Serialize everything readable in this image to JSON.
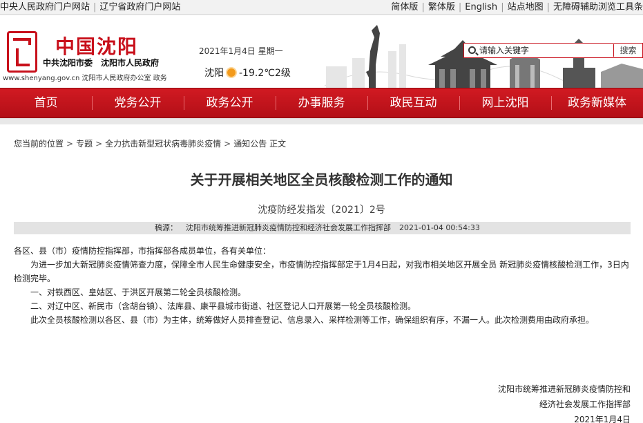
{
  "topbar": {
    "links_left": [
      "中央人民政府门户网站",
      "辽宁省政府门户网站"
    ],
    "links_right": [
      "简体版",
      "繁体版",
      "English",
      "站点地图",
      "无障碍辅助浏览工具条"
    ]
  },
  "header": {
    "logo_title": "中国沈阳",
    "logo_subtitle": "中共沈阳市委　沈阳市人民政府",
    "logo_url": "www.shenyang.gov.cn 沈阳市人民政府办公室 政务",
    "date": "2021年1月4日 星期一",
    "weather": {
      "city": "沈阳",
      "temperature": "-19.2℃",
      "wind": "2级",
      "icon": "sun-icon"
    }
  },
  "search": {
    "placeholder": "请输入关键字",
    "button_label": "搜索"
  },
  "nav": {
    "items": [
      "首页",
      "党务公开",
      "政务公开",
      "办事服务",
      "政民互动",
      "网上沈阳",
      "政务新媒体"
    ]
  },
  "breadcrumb": {
    "prefix": "您当前的位置",
    "items": [
      "专题",
      "全力抗击新型冠状病毒肺炎疫情",
      "通知公告",
      "正文"
    ]
  },
  "article": {
    "title": "关于开展相关地区全员核酸检测工作的通知",
    "doc_number": "沈疫防经发指发〔2021〕2号",
    "source_label": "稿源：",
    "source": "沈阳市统筹推进新冠肺炎疫情防控和经济社会发展工作指挥部",
    "published": "2021-01-04 00:54:33",
    "salutation": "各区、县（市）疫情防控指挥部，市指挥部各成员单位，各有关单位：",
    "paragraphs": [
      "为进一步加大新冠肺炎疫情筛查力度，保障全市人民生命健康安全，市疫情防控指挥部定于1月4日起，对我市相关地区开展全员 新冠肺炎疫情核酸检测工作，3日内检测完毕。",
      "一、对铁西区、皇姑区、于洪区开展第二轮全员核酸检测。",
      "二、对辽中区、新民市（含胡台镇）、法库县、康平县城市街道、社区登记人口开展第一轮全员核酸检测。",
      "此次全员核酸检测以各区、县（市）为主体，统筹做好人员排查登记、信息录入、采样检测等工作，确保组织有序，不漏一人。此次检测费用由政府承担。"
    ],
    "signature": [
      "沈阳市统筹推进新冠肺炎疫情防控和",
      "经济社会发展工作指挥部",
      "2021年1月4日"
    ]
  },
  "colors": {
    "brand_red": "#c8101b",
    "nav_red": "#c4141c"
  }
}
